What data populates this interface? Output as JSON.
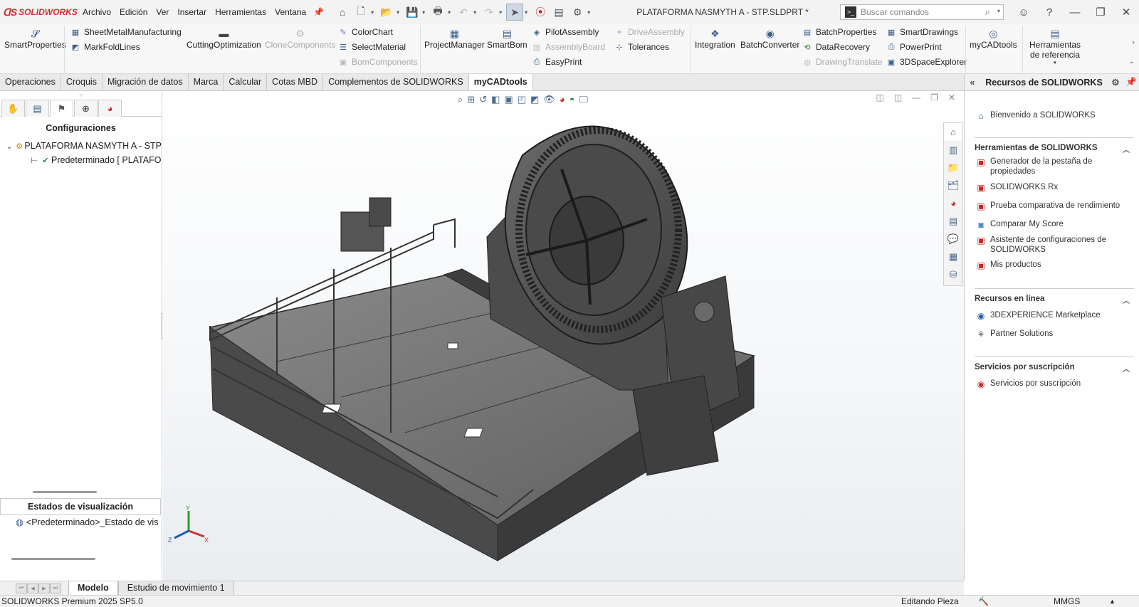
{
  "titlebar": {
    "logo": "SOLIDWORKS",
    "menus": [
      "Archivo",
      "Edición",
      "Ver",
      "Insertar",
      "Herramientas",
      "Ventana"
    ],
    "document_title": "PLATAFORMA NASMYTH  A - STP.SLDPRT *",
    "search_placeholder": "Buscar comandos"
  },
  "ribbon": {
    "smart_properties": "SmartProperties",
    "sheetmetal": "SheetMetalManufacturing",
    "markfold": "MarkFoldLines",
    "cutting": "CuttingOptimization",
    "clone": "CloneComponents",
    "colorchart": "ColorChart",
    "selectmaterial": "SelectMaterial",
    "bomcomponents": "BomComponents",
    "projectmanager": "ProjectManager",
    "smartbom": "SmartBom",
    "pilotassembly": "PilotAssembly",
    "assemblyboard": "AssemblyBoard",
    "easyprint": "EasyPrint",
    "driveassembly": "DriveAssembly",
    "tolerances": "Tolerances",
    "integration": "Integration",
    "batchconverter": "BatchConverter",
    "batchproperties": "BatchProperties",
    "datarecovery": "DataRecovery",
    "drawingtranslate": "DrawingTranslate",
    "smartdrawings": "SmartDrawings",
    "powerprint": "PowerPrint",
    "spaceexplorer": "3DSpaceExplorer",
    "mycadtools": "myCADtools",
    "herramientas_ref": "Herramientas de referencia"
  },
  "tabs": [
    "Operaciones",
    "Croquis",
    "Migración de datos",
    "Marca",
    "Calcular",
    "Cotas MBD",
    "Complementos de SOLIDWORKS",
    "myCADtools"
  ],
  "active_tab": "myCADtools",
  "leftpanel": {
    "header": "Configuraciones",
    "tree_root": "PLATAFORMA NASMYTH  A - STP",
    "tree_child": "Predeterminado [ PLATAFO",
    "visual_states_header": "Estados de visualización",
    "visual_state": "<Predeterminado>_Estado de vis"
  },
  "taskpane": {
    "title": "Recursos de SOLIDWORKS",
    "welcome": "Bienvenido a SOLIDWORKS",
    "tools_section": "Herramientas de SOLIDWORKS",
    "tools": [
      "Generador de la pestaña de propiedades",
      "SOLIDWORKS Rx",
      "Prueba comparativa de rendimiento",
      "Comparar My Score",
      "Asistente de configuraciones de SOLIDWORKS",
      "Mis productos"
    ],
    "online_section": "Recursos en línea",
    "online": [
      "3DEXPERIENCE Marketplace",
      "Partner Solutions"
    ],
    "subscription_section": "Servicios por suscripción",
    "subscription": [
      "Servicios por suscripción"
    ]
  },
  "bottom_tabs": [
    "Modelo",
    "Estudio de movimiento 1"
  ],
  "status": {
    "left": "SOLIDWORKS Premium 2025 SP5.0",
    "mode": "Editando Pieza",
    "units": "MMGS"
  },
  "triad": {
    "x": "X",
    "y": "Y",
    "z": "Z"
  },
  "colors": {
    "brand": "#d32f2f",
    "accent": "#3a5f8a",
    "model": "#5a5a5a"
  }
}
